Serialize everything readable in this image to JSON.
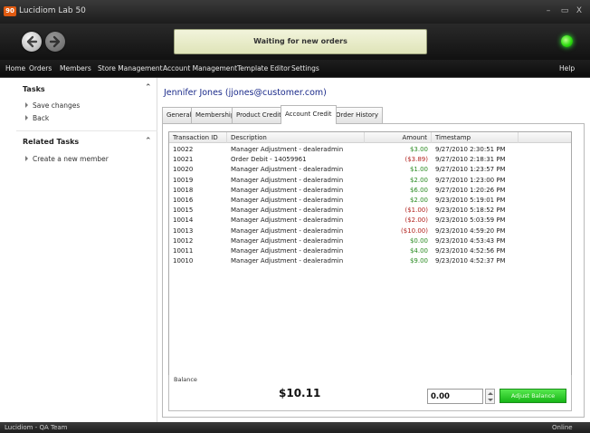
{
  "app": {
    "logo": "90",
    "title": "Lucidiom Lab 50"
  },
  "window_controls": {
    "minimize": "–",
    "maximize": "▭",
    "close": "X"
  },
  "toolbar": {
    "status_text": "Waiting for new orders",
    "status_color": "#22dd11",
    "back_icon": "back-arrow-icon",
    "forward_icon": "forward-arrow-icon"
  },
  "menu": {
    "items": [
      "Home",
      "Orders",
      "Members",
      "Store Management",
      "Account Management",
      "Template Editor",
      "Settings"
    ],
    "help": "Help"
  },
  "sidebar": {
    "tasks_title": "Tasks",
    "tasks": [
      "Save changes",
      "Back"
    ],
    "related_title": "Related Tasks",
    "related": [
      "Create a new member"
    ]
  },
  "member": {
    "title": "Jennifer Jones (jjones@customer.com)"
  },
  "tabs": [
    "General",
    "Membership",
    "Product Credits",
    "Account Credit",
    "Order History"
  ],
  "active_tab": "Account Credit",
  "table": {
    "columns": [
      "Transaction ID",
      "Description",
      "Amount",
      "Timestamp"
    ],
    "rows": [
      {
        "id": "10022",
        "description": "Manager Adjustment - dealeradmin",
        "amount": "$3.00",
        "timestamp": "9/27/2010 2:30:51 PM",
        "sign": "pos"
      },
      {
        "id": "10021",
        "description": "Order Debit - 14059961",
        "amount": "($3.89)",
        "timestamp": "9/27/2010 2:18:31 PM",
        "sign": "neg"
      },
      {
        "id": "10020",
        "description": "Manager Adjustment - dealeradmin",
        "amount": "$1.00",
        "timestamp": "9/27/2010 1:23:57 PM",
        "sign": "pos"
      },
      {
        "id": "10019",
        "description": "Manager Adjustment - dealeradmin",
        "amount": "$2.00",
        "timestamp": "9/27/2010 1:23:00 PM",
        "sign": "pos"
      },
      {
        "id": "10018",
        "description": "Manager Adjustment - dealeradmin",
        "amount": "$6.00",
        "timestamp": "9/27/2010 1:20:26 PM",
        "sign": "pos"
      },
      {
        "id": "10016",
        "description": "Manager Adjustment - dealeradmin",
        "amount": "$2.00",
        "timestamp": "9/23/2010 5:19:01 PM",
        "sign": "pos"
      },
      {
        "id": "10015",
        "description": "Manager Adjustment - dealeradmin",
        "amount": "($1.00)",
        "timestamp": "9/23/2010 5:18:52 PM",
        "sign": "neg"
      },
      {
        "id": "10014",
        "description": "Manager Adjustment - dealeradmin",
        "amount": "($2.00)",
        "timestamp": "9/23/2010 5:03:59 PM",
        "sign": "neg"
      },
      {
        "id": "10013",
        "description": "Manager Adjustment - dealeradmin",
        "amount": "($10.00)",
        "timestamp": "9/23/2010 4:59:20 PM",
        "sign": "neg"
      },
      {
        "id": "10012",
        "description": "Manager Adjustment - dealeradmin",
        "amount": "$0.00",
        "timestamp": "9/23/2010 4:53:43 PM",
        "sign": "pos"
      },
      {
        "id": "10011",
        "description": "Manager Adjustment - dealeradmin",
        "amount": "$4.00",
        "timestamp": "9/23/2010 4:52:56 PM",
        "sign": "pos"
      },
      {
        "id": "10010",
        "description": "Manager Adjustment - dealeradmin",
        "amount": "$9.00",
        "timestamp": "9/23/2010 4:52:37 PM",
        "sign": "pos"
      }
    ]
  },
  "balance": {
    "label": "Balance",
    "value": "$10.11",
    "adjust_value": "0.00",
    "adjust_button": "Adjust Balance"
  },
  "colors": {
    "positive": "#2a8a22",
    "negative": "#b2231f",
    "accent_green": "#22dd11",
    "title_blue": "#1a2a8a"
  },
  "statusbar": {
    "left": "Lucidiom - QA Team",
    "right": "Online"
  }
}
